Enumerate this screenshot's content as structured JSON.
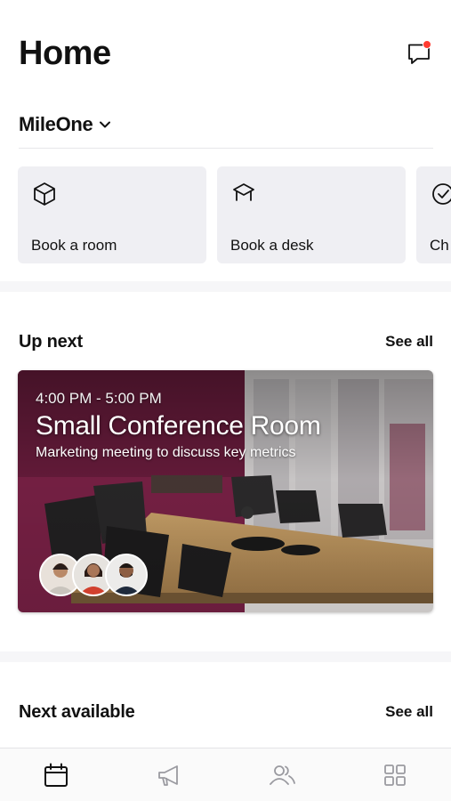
{
  "header": {
    "title": "Home",
    "chat_icon": "chat-bubble-icon",
    "notification_color": "#ff3b30"
  },
  "org": {
    "name": "MileOne",
    "chevron_icon": "chevron-down-icon"
  },
  "quick_actions": [
    {
      "label": "Book a room",
      "icon": "cube-icon"
    },
    {
      "label": "Book a desk",
      "icon": "desk-icon"
    },
    {
      "label": "Ch",
      "icon": "check-circle-icon"
    }
  ],
  "up_next": {
    "title": "Up next",
    "see_all": "See all",
    "event": {
      "time": "4:00 PM - 5:00 PM",
      "room": "Small Conference Room",
      "description": "Marketing meeting to discuss key metrics",
      "attendee_count": 3
    }
  },
  "next_available": {
    "title": "Next available",
    "see_all": "See all"
  },
  "bottom_nav": [
    {
      "icon": "calendar-icon",
      "active": true
    },
    {
      "icon": "megaphone-icon",
      "active": false
    },
    {
      "icon": "people-icon",
      "active": false
    },
    {
      "icon": "grid-icon",
      "active": false
    }
  ],
  "colors": {
    "tile_bg": "#efeff3",
    "active_icon": "#111111",
    "inactive_icon": "#9a9aa0"
  }
}
